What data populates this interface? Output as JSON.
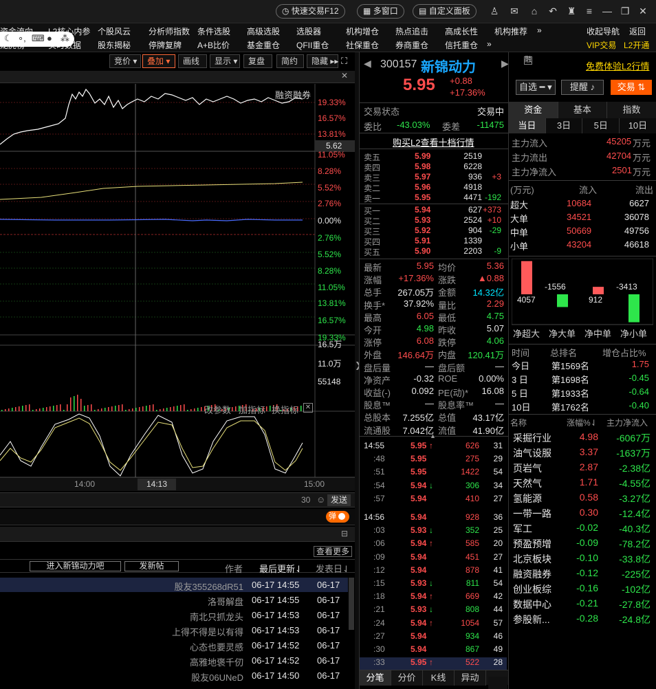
{
  "top": {
    "quick_trade": "快速交易F12",
    "multi_window": "多窗口",
    "custom_panel": "自定义面板"
  },
  "menu": {
    "row1": [
      "资金流向",
      "L2核心内参",
      "个股风云",
      "分析师指数",
      "条件选股",
      "高级选股",
      "选股器",
      "机构增仓",
      "热点追击",
      "高成长性",
      "机构推荐",
      "»",
      "收起导航",
      "返回"
    ],
    "row2": [
      "龙虎榜",
      "实时数据",
      "股东揭秘",
      "停牌复牌",
      "A+B比价",
      "基金重仓",
      "QFII重仓",
      "社保重仓",
      "券商重仓",
      "信托重仓",
      "»",
      "VIP交易",
      "L2开通"
    ]
  },
  "chart_toolbar": [
    "竞价",
    "叠加",
    "画线",
    "显示",
    "复盘",
    "简约",
    "隐藏"
  ],
  "chart": {
    "margin_label": "融资融券",
    "price_axis": [
      "19.33%",
      "16.57%",
      "13.81%",
      "5.62",
      "11.05%",
      "8.28%",
      "5.52%",
      "2.76%",
      "0.00%",
      "2.76%",
      "5.52%",
      "8.28%",
      "11.05%",
      "13.81%",
      "16.57%",
      "19.33%"
    ],
    "volume_axis": [
      "16.5万",
      "11.0万",
      "55148"
    ],
    "indicator_controls": [
      "改参数",
      "加指标",
      "换指标"
    ],
    "time_labels": [
      "14:00",
      "14:13",
      "15:00"
    ],
    "chat_count": "30",
    "send_label": "发送",
    "danmu_label": "弹"
  },
  "forum": {
    "view_more": "查看更多",
    "enter_bar": "进入新锦动力吧",
    "new_post": "发新帖",
    "col_author": "作者",
    "col_updated": "最后更新⇃",
    "col_posted": "发表日⇃",
    "rows": [
      {
        "author": "股友355268dR51",
        "updated": "06-17 14:55",
        "posted": "06-17"
      },
      {
        "author": "洛哥解盘",
        "updated": "06-17 14:55",
        "posted": "06-17"
      },
      {
        "author": "南北只抓龙头",
        "updated": "06-17 14:53",
        "posted": "06-17"
      },
      {
        "author": "上得不得是以有得",
        "updated": "06-17 14:53",
        "posted": "06-17"
      },
      {
        "author": "心态也要灵感",
        "updated": "06-17 14:52",
        "posted": "06-17"
      },
      {
        "author": "高雅地褒千仞",
        "updated": "06-17 14:52",
        "posted": "06-17"
      },
      {
        "author": "股友06UNeD",
        "updated": "06-17 14:50",
        "posted": "06-17"
      }
    ]
  },
  "stock": {
    "code": "300157",
    "name": "新锦动力",
    "margin_badge": "融",
    "l2_link": "免费体验L2行情",
    "price": "5.95",
    "change": "+0.88",
    "change_pct": "+17.36%",
    "watch_btn": "自选",
    "alert_btn": "提醒",
    "trade_btn": "交易"
  },
  "quote": {
    "status_label": "交易状态",
    "status_value": "交易中",
    "weibi_label": "委比",
    "weibi_value": "-43.03%",
    "weicha_label": "委差",
    "weicha_value": "-11475",
    "l2_buy": "购买L2查看十档行情",
    "asks": [
      {
        "label": "卖五",
        "price": "5.99",
        "vol": "2519",
        "chg": ""
      },
      {
        "label": "卖四",
        "price": "5.98",
        "vol": "6228",
        "chg": ""
      },
      {
        "label": "卖三",
        "price": "5.97",
        "vol": "936",
        "chg": "+3"
      },
      {
        "label": "卖二",
        "price": "5.96",
        "vol": "4918",
        "chg": ""
      },
      {
        "label": "卖一",
        "price": "5.95",
        "vol": "4471",
        "chg": "-192"
      }
    ],
    "bids": [
      {
        "label": "买一",
        "price": "5.94",
        "vol": "627",
        "chg": "+373"
      },
      {
        "label": "买二",
        "price": "5.93",
        "vol": "2524",
        "chg": "+10"
      },
      {
        "label": "买三",
        "price": "5.92",
        "vol": "904",
        "chg": "-29"
      },
      {
        "label": "买四",
        "price": "5.91",
        "vol": "1339",
        "chg": ""
      },
      {
        "label": "买五",
        "price": "5.90",
        "vol": "2203",
        "chg": "-9"
      }
    ],
    "stats": [
      {
        "l1": "最新",
        "v1": "5.95",
        "c1": "red",
        "l2": "均价",
        "v2": "5.36",
        "c2": "red"
      },
      {
        "l1": "涨幅",
        "v1": "+17.36%",
        "c1": "red",
        "l2": "涨跌",
        "v2": "▲0.88",
        "c2": "red"
      },
      {
        "l1": "总手",
        "v1": "267.05万",
        "c1": "wht",
        "l2": "金额",
        "v2": "14.32亿",
        "c2": "cyn"
      },
      {
        "l1": "换手*",
        "v1": "37.92%",
        "c1": "wht",
        "l2": "量比",
        "v2": "2.29",
        "c2": "red"
      },
      {
        "l1": "最高",
        "v1": "6.05",
        "c1": "red",
        "l2": "最低",
        "v2": "4.75",
        "c2": "grn"
      },
      {
        "l1": "今开",
        "v1": "4.98",
        "c1": "grn",
        "l2": "昨收",
        "v2": "5.07",
        "c2": "wht"
      },
      {
        "l1": "涨停",
        "v1": "6.08",
        "c1": "red",
        "l2": "跌停",
        "v2": "4.06",
        "c2": "grn"
      },
      {
        "l1": "外盘",
        "v1": "146.64万",
        "c1": "red",
        "l2": "内盘",
        "v2": "120.41万",
        "c2": "grn"
      },
      {
        "l1": "盘后量",
        "v1": "—",
        "c1": "wht",
        "l2": "盘后额",
        "v2": "—",
        "c2": "wht"
      },
      {
        "l1": "净资产",
        "v1": "-0.32",
        "c1": "wht",
        "l2": "ROE",
        "v2": "0.00%",
        "c2": "wht"
      },
      {
        "l1": "收益(-)",
        "v1": "0.092",
        "c1": "wht",
        "l2": "PE(动)*",
        "v2": "16.08",
        "c2": "wht"
      },
      {
        "l1": "股息™",
        "v1": "—",
        "c1": "wht",
        "l2": "股息率™",
        "v2": "—",
        "c2": "wht"
      },
      {
        "l1": "总股本",
        "v1": "7.255亿",
        "c1": "wht",
        "l2": "总值",
        "v2": "43.17亿",
        "c2": "wht"
      },
      {
        "l1": "流通股",
        "v1": "7.042亿",
        "c1": "wht",
        "l2": "流值",
        "v2": "41.90亿",
        "c2": "wht"
      }
    ],
    "ticks": [
      {
        "t": "14:55",
        "p": "5.95",
        "a": "↑",
        "v": "626",
        "n": "31",
        "pc": "red",
        "vc": "red"
      },
      {
        "t": ":48",
        "p": "5.95",
        "a": "",
        "v": "275",
        "n": "29",
        "pc": "red",
        "vc": "red"
      },
      {
        "t": ":51",
        "p": "5.95",
        "a": "",
        "v": "1422",
        "n": "54",
        "pc": "red",
        "vc": "red"
      },
      {
        "t": ":54",
        "p": "5.94",
        "a": "↓",
        "v": "306",
        "n": "34",
        "pc": "red",
        "vc": "grn"
      },
      {
        "t": ":57",
        "p": "5.94",
        "a": "",
        "v": "410",
        "n": "27",
        "pc": "red",
        "vc": "red"
      },
      {
        "t": "14:56",
        "p": "5.94",
        "a": "",
        "v": "928",
        "n": "36",
        "pc": "red",
        "vc": "red"
      },
      {
        "t": ":03",
        "p": "5.93",
        "a": "↓",
        "v": "352",
        "n": "25",
        "pc": "red",
        "vc": "grn"
      },
      {
        "t": ":06",
        "p": "5.94",
        "a": "↑",
        "v": "585",
        "n": "20",
        "pc": "red",
        "vc": "red"
      },
      {
        "t": ":09",
        "p": "5.94",
        "a": "",
        "v": "451",
        "n": "27",
        "pc": "red",
        "vc": "red"
      },
      {
        "t": ":12",
        "p": "5.94",
        "a": "",
        "v": "878",
        "n": "41",
        "pc": "red",
        "vc": "red"
      },
      {
        "t": ":15",
        "p": "5.93",
        "a": "↓",
        "v": "811",
        "n": "54",
        "pc": "red",
        "vc": "grn"
      },
      {
        "t": ":18",
        "p": "5.94",
        "a": "↑",
        "v": "669",
        "n": "42",
        "pc": "red",
        "vc": "red"
      },
      {
        "t": ":21",
        "p": "5.93",
        "a": "↓",
        "v": "808",
        "n": "44",
        "pc": "red",
        "vc": "grn"
      },
      {
        "t": ":24",
        "p": "5.94",
        "a": "↑",
        "v": "1054",
        "n": "57",
        "pc": "red",
        "vc": "red"
      },
      {
        "t": ":27",
        "p": "5.94",
        "a": "",
        "v": "934",
        "n": "46",
        "pc": "red",
        "vc": "grn"
      },
      {
        "t": ":30",
        "p": "5.94",
        "a": "",
        "v": "867",
        "n": "49",
        "pc": "red",
        "vc": "grn"
      },
      {
        "t": ":33",
        "p": "5.95",
        "a": "↑",
        "v": "522",
        "n": "28",
        "pc": "red",
        "vc": "red"
      }
    ],
    "bottom_tabs": [
      "分笔",
      "分价",
      "K线",
      "异动"
    ]
  },
  "fund": {
    "tabs": [
      "资金",
      "基本",
      "指数"
    ],
    "periods": [
      "当日",
      "3日",
      "5日",
      "10日"
    ],
    "main_in_label": "主力流入",
    "main_in": "45205",
    "main_out_label": "主力流出",
    "main_out": "42704",
    "main_net_label": "主力净流入",
    "main_net": "2501",
    "unit": "万元",
    "hdr_unit": "(万元)",
    "hdr_in": "流入",
    "hdr_out": "流出",
    "flows": [
      {
        "label": "超大",
        "in": "10684",
        "out": "6627"
      },
      {
        "label": "大单",
        "in": "34521",
        "out": "36078"
      },
      {
        "label": "中单",
        "in": "50669",
        "out": "49756"
      },
      {
        "label": "小单",
        "in": "43204",
        "out": "46618"
      }
    ],
    "net_chart": {
      "categories": [
        "净超大",
        "净大单",
        "净中单",
        "净小单"
      ],
      "values": [
        4057,
        -1556,
        912,
        -3413
      ],
      "labels": [
        "4057",
        "-1556",
        "912",
        "-3413"
      ]
    },
    "rank_hdr": {
      "time": "时间",
      "rank": "总排名",
      "inc": "增仓占比%"
    },
    "ranks": [
      {
        "t": "今日",
        "r": "第1569名",
        "v": "1.75",
        "c": "red"
      },
      {
        "t": "3 日",
        "r": "第1698名",
        "v": "-0.45",
        "c": "grn"
      },
      {
        "t": "5 日",
        "r": "第1933名",
        "v": "-0.64",
        "c": "grn"
      },
      {
        "t": "10日",
        "r": "第1762名",
        "v": "-0.40",
        "c": "grn"
      }
    ],
    "sector_hdr": {
      "name": "名称",
      "pct": "涨幅%⇃",
      "net": "主力净流入"
    },
    "sectors": [
      {
        "n": "采掘行业",
        "p": "4.98",
        "v": "-6067万",
        "pc": "red"
      },
      {
        "n": "油气设服",
        "p": "3.37",
        "v": "-1637万",
        "pc": "red"
      },
      {
        "n": "页岩气",
        "p": "2.87",
        "v": "-2.38亿",
        "pc": "red"
      },
      {
        "n": "天然气",
        "p": "1.71",
        "v": "-4.55亿",
        "pc": "red"
      },
      {
        "n": "氢能源",
        "p": "0.58",
        "v": "-3.27亿",
        "pc": "red"
      },
      {
        "n": "一带一路",
        "p": "0.30",
        "v": "-12.4亿",
        "pc": "red"
      },
      {
        "n": "军工",
        "p": "-0.02",
        "v": "-40.3亿",
        "pc": "grn"
      },
      {
        "n": "预盈预增",
        "p": "-0.09",
        "v": "-78.2亿",
        "pc": "grn"
      },
      {
        "n": "北京板块",
        "p": "-0.10",
        "v": "-33.8亿",
        "pc": "grn"
      },
      {
        "n": "融资融券",
        "p": "-0.12",
        "v": "-225亿",
        "pc": "grn"
      },
      {
        "n": "创业板综",
        "p": "-0.16",
        "v": "-102亿",
        "pc": "grn"
      },
      {
        "n": "数据中心",
        "p": "-0.21",
        "v": "-27.8亿",
        "pc": "grn"
      },
      {
        "n": "参股新...",
        "p": "-0.28",
        "v": "-24.8亿",
        "pc": "grn"
      }
    ]
  }
}
